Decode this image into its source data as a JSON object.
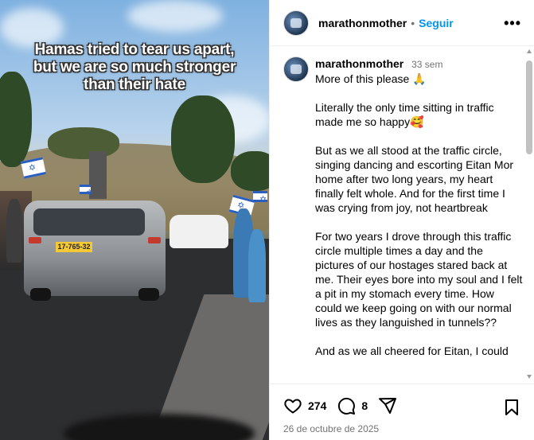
{
  "media": {
    "overlay_line1": "Hamas tried to tear us apart,",
    "overlay_line2": "but we are so much stronger",
    "overlay_line3": "than their hate",
    "plate": "17-765-32"
  },
  "header": {
    "username": "marathonmother",
    "separator": "•",
    "follow_label": "Seguir",
    "more_icon": "more-horizontal-icon",
    "more_label": "•••"
  },
  "caption": {
    "username": "marathonmother",
    "time": "33 sem",
    "paragraphs": [
      "More of this please 🙏",
      "Literally the only time sitting in traffic made me so happy🥰",
      "But as we all stood at the traffic circle, singing dancing and escorting Eitan Mor home after two long years, my heart finally felt whole. And for the first time I was crying from joy, not heartbreak",
      "For two years I drove through this traffic circle multiple times a day and the pictures of our hostages stared back at me. Their eyes bore into my soul and I felt a pit in my stomach every time. How could we keep going on with our normal lives as they languished in tunnels??",
      "And as we all cheered for Eitan, I could"
    ]
  },
  "actions": {
    "like_icon": "heart-icon",
    "likes": "274",
    "comment_icon": "comment-icon",
    "comments": "8",
    "share_icon": "send-icon",
    "save_icon": "bookmark-icon",
    "date": "26 de octubre de 2025"
  }
}
